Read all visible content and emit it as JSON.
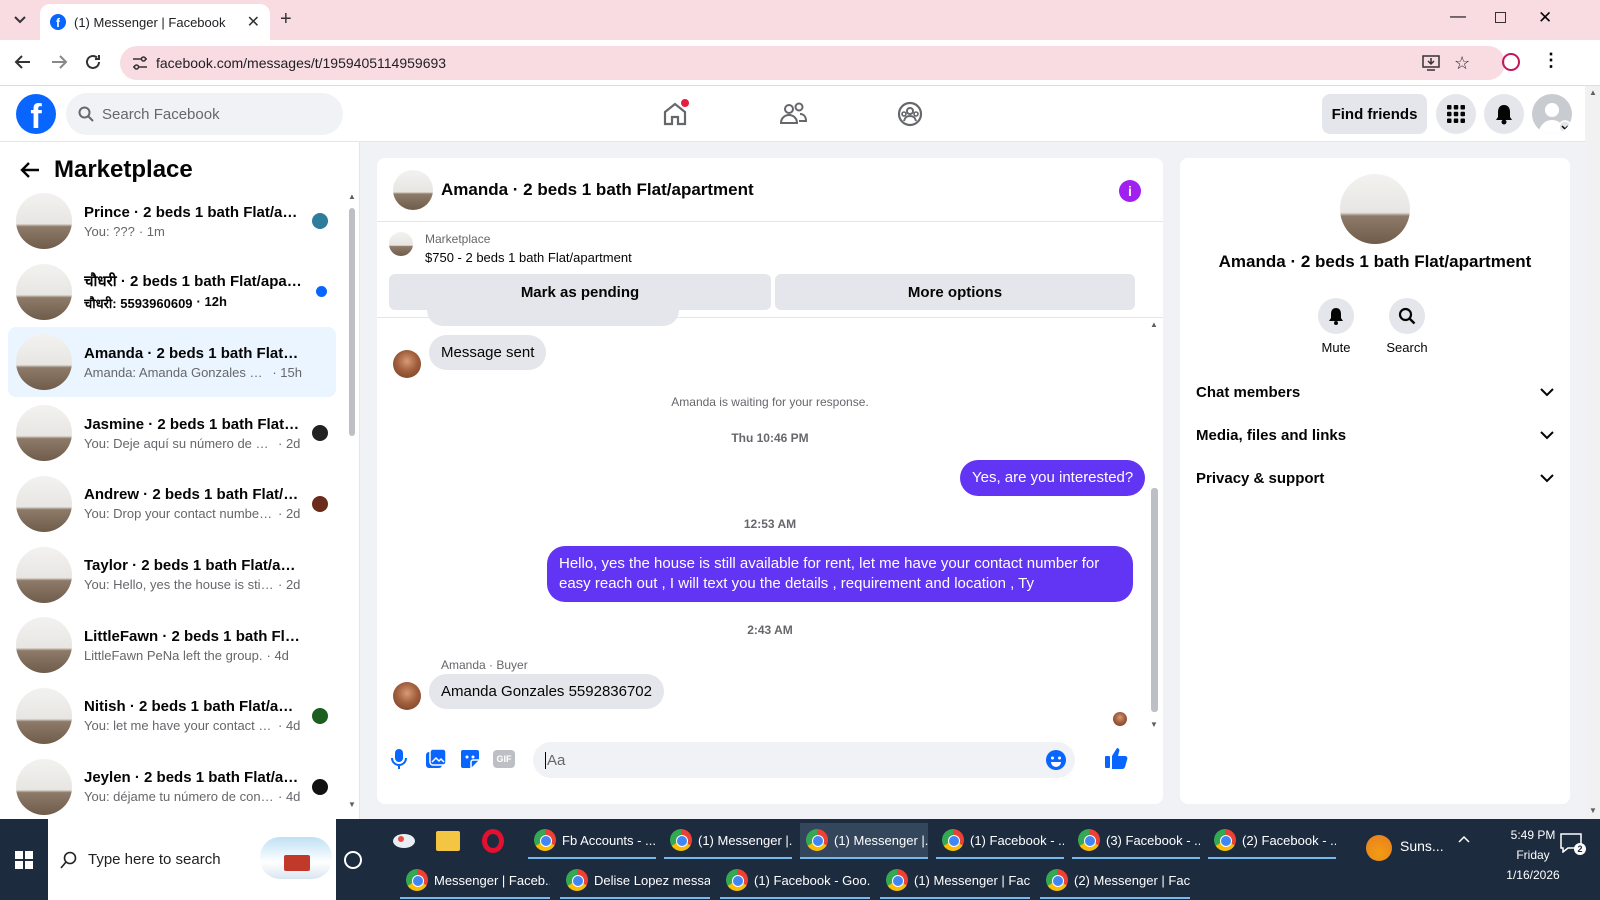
{
  "browser": {
    "tab_title": "(1) Messenger | Facebook",
    "url": "facebook.com/messages/t/1959405114959693"
  },
  "fb": {
    "search_placeholder": "Search Facebook",
    "find_friends": "Find friends"
  },
  "left": {
    "title": "Marketplace",
    "conversations": [
      {
        "name": "Prince · 2 beds 1 bath Flat/apa...",
        "preview": "You: ???",
        "time": "· 1m",
        "bold": false
      },
      {
        "name": "चौधरी · 2 beds 1 bath Flat/apar...",
        "preview": "चौधरी: 5593960609",
        "time": "· 12h",
        "bold": true
      },
      {
        "name": "Amanda · 2 beds 1 bath Flat/apa...",
        "preview": "Amanda: Amanda Gonzales 5592...",
        "time": "· 15h",
        "bold": false
      },
      {
        "name": "Jasmine · 2 beds 1 bath Flat/a...",
        "preview": "You: Deje aquí su número de co...",
        "time": "· 2d",
        "bold": false
      },
      {
        "name": "Andrew · 2 beds 1 bath Flat/a...",
        "preview": "You: Drop your contact number ...",
        "time": "· 2d",
        "bold": false
      },
      {
        "name": "Taylor · 2 beds 1 bath Flat/apart...",
        "preview": "You: Hello, yes the house is still ava...",
        "time": "· 2d",
        "bold": false
      },
      {
        "name": "LittleFawn · 2 beds 1 bath Flat/a...",
        "preview": "LittleFawn PeNa left the group.",
        "time": "· 4d",
        "bold": false
      },
      {
        "name": "Nitish · 2 beds 1 bath Flat/apa...",
        "preview": "You: let me have your contact n...",
        "time": "· 4d",
        "bold": false
      },
      {
        "name": "Jeylen · 2 beds 1 bath Flat/apa...",
        "preview": "You: déjame tu número de conta...",
        "time": "· 4d",
        "bold": false
      }
    ]
  },
  "chat": {
    "title": "Amanda · 2 beds 1 bath Flat/apartment",
    "marketplace_label": "Marketplace",
    "listing": "$750 - 2 beds 1 bath Flat/apartment",
    "mark_pending": "Mark as pending",
    "more_options": "More options",
    "msg1": "Message sent",
    "waiting": "Amanda is waiting for your response.",
    "time1": "Thu 10:46 PM",
    "sent1": "Yes, are you interested?",
    "time2": "12:53 AM",
    "sent2": "Hello, yes the house is still available for rent, let me have your contact number for easy reach out , I will text you the details , requirement and location , Ty",
    "time3": "2:43 AM",
    "sender_label": "Amanda · Buyer",
    "msg2": "Amanda Gonzales 5592836702",
    "input_placeholder": "Aa"
  },
  "right": {
    "name": "Amanda · 2 beds 1 bath Flat/apartment",
    "mute": "Mute",
    "search": "Search",
    "chat_members": "Chat members",
    "media": "Media, files and links",
    "privacy": "Privacy & support"
  },
  "taskbar": {
    "search_placeholder": "Type here to search",
    "row1": [
      {
        "label": "Fb Accounts - ...",
        "active": false
      },
      {
        "label": "(1) Messenger |...",
        "active": false
      },
      {
        "label": "(1) Messenger |...",
        "active": true
      },
      {
        "label": "(1) Facebook - ...",
        "active": false
      },
      {
        "label": "(3) Facebook - ...",
        "active": false
      },
      {
        "label": "(2) Facebook - ...",
        "active": false
      }
    ],
    "row2": [
      {
        "label": "Messenger | Faceb..."
      },
      {
        "label": "Delise Lopez messa..."
      },
      {
        "label": "(1) Facebook - Goo..."
      },
      {
        "label": "(1) Messenger | Fac..."
      },
      {
        "label": "(2) Messenger | Fac..."
      }
    ],
    "weather": "Suns...",
    "time": "5:49 PM",
    "day": "Friday",
    "date": "1/16/2026"
  },
  "colors": {
    "fb_blue": "#0866ff",
    "sent_bubble": "#6234f4",
    "tab_strip": "#f9dbe2",
    "taskbar": "#1d2b3f"
  }
}
